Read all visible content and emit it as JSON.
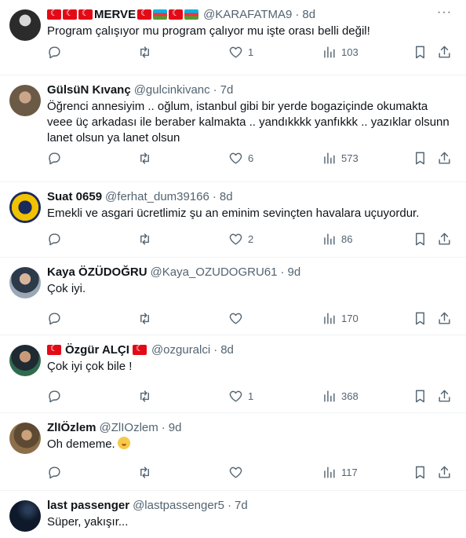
{
  "tweets": [
    {
      "name": "MERVE",
      "flags_before": [
        "tr",
        "tr",
        "tr"
      ],
      "flags_after": [
        "tr",
        "az",
        "tr",
        "az"
      ],
      "handle": "@KARAFATMA9",
      "time": "8d",
      "text": "Program çalışıyor mu program çalıyor mu işte orası belli değil!",
      "replies": "",
      "retweets": "",
      "likes": "1",
      "views": "103",
      "avatar_color": "#2b2b2b"
    },
    {
      "name": "GülsüN Kıvanç",
      "handle": "@gulcinkivanc",
      "time": "7d",
      "text": "Öğrenci annesiyim .. oğlum, istanbul gibi bir yerde bogaziçinde okumakta veee üç arkadası ile beraber kalmakta .. yandıkkkk yanfıkkk .. yazıklar olsunn lanet olsun ya lanet olsun",
      "replies": "",
      "retweets": "",
      "likes": "6",
      "views": "573",
      "avatar_color": "#6b5a45"
    },
    {
      "name": "Suat 0659",
      "handle": "@ferhat_dum39166",
      "time": "8d",
      "text": "Emekli ve asgari ücretlimiz şu an eminim sevinçten havalara uçuyordur.",
      "replies": "",
      "retweets": "",
      "likes": "2",
      "views": "86",
      "avatar_color": "#f2c200"
    },
    {
      "name": "Kaya ÖZÜDOĞRU",
      "handle": "@Kaya_OZUDOGRU61",
      "time": "9d",
      "text": "Çok iyi.",
      "replies": "",
      "retweets": "",
      "likes": "",
      "views": "170",
      "avatar_color": "#7d8a99"
    },
    {
      "name": "Özgür ALÇI",
      "flags_before": [
        "tr"
      ],
      "flags_after": [
        "tr"
      ],
      "handle": "@ozguralci",
      "time": "8d",
      "text": "Çok iyi çok bile !",
      "replies": "",
      "retweets": "",
      "likes": "1",
      "views": "368",
      "avatar_color": "#2f6b4f"
    },
    {
      "name": "ZlIÖzlem",
      "handle": "@ZlIOzlem",
      "time": "9d",
      "text": "Oh dememe.",
      "emoji": "shushing-face",
      "replies": "",
      "retweets": "",
      "likes": "",
      "views": "117",
      "avatar_color": "#8c6f4a"
    },
    {
      "name": "last passenger",
      "handle": "@lastpassenger5",
      "time": "7d",
      "text": "Süper, yakışır...",
      "avatar_color": "#0e1a2b"
    }
  ],
  "icons": {
    "reply": "reply-icon",
    "retweet": "retweet-icon",
    "like": "heart-icon",
    "views": "views-icon",
    "bookmark": "bookmark-icon",
    "share": "share-icon",
    "more": "more-icon"
  },
  "colors": {
    "muted": "#536471",
    "text": "#0f1419",
    "divider": "#eff3f4"
  },
  "more_glyph": "···",
  "separator": "·"
}
